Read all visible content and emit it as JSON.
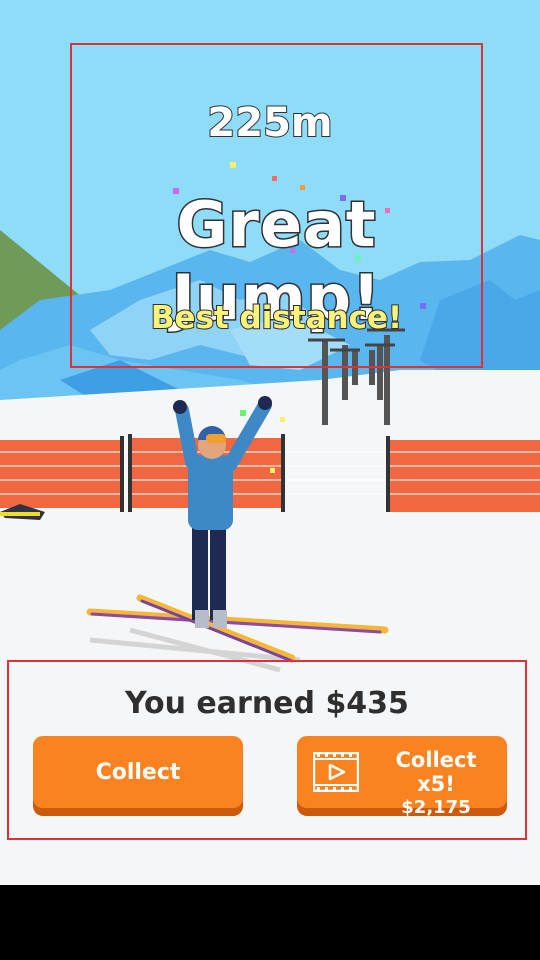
{
  "result": {
    "distance": "225m",
    "headline": "Great Jump!",
    "subtitle": "Best distance!"
  },
  "reward": {
    "earned_text": "You earned $435",
    "collect_label": "Collect",
    "collect_x5_label": "Collect x5!",
    "collect_x5_amount": "$2,175",
    "video_icon": "film-play-icon"
  },
  "colors": {
    "button": "#fb8220",
    "button_shadow": "#cc5a0c",
    "highlight_box": "#e0303a",
    "subtitle": "#fbf27a"
  }
}
